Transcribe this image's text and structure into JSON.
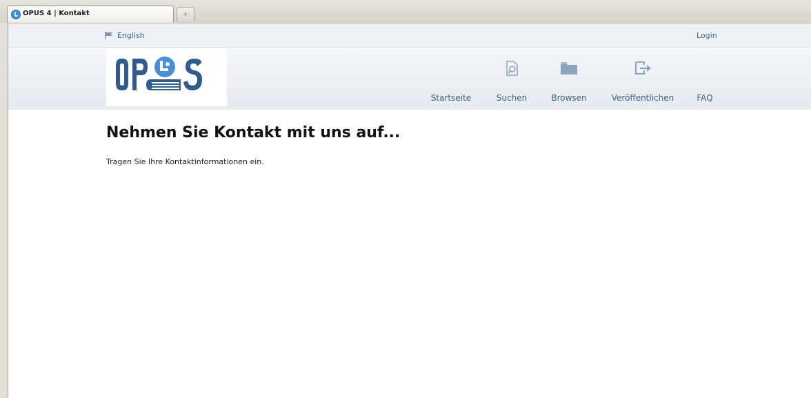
{
  "browser": {
    "tab_title": "OPUS 4 | Kontakt",
    "new_tab_symbol": "+"
  },
  "topbar": {
    "language_link": "English",
    "login_link": "Login"
  },
  "header": {
    "logo_alt": "OPUS",
    "nav": [
      {
        "label": "Startseite",
        "icon": "none"
      },
      {
        "label": "Suchen",
        "icon": "search-document-icon"
      },
      {
        "label": "Browsen",
        "icon": "folder-icon"
      },
      {
        "label": "Veröffentlichen",
        "icon": "publish-arrow-icon"
      },
      {
        "label": "FAQ",
        "icon": "none"
      }
    ]
  },
  "main": {
    "heading": "Nehmen Sie Kontakt mit uns auf...",
    "intro": "Tragen Sie Ihre Kontaktinformationen ein."
  },
  "colors": {
    "link": "#3d6187",
    "logo_blue": "#2f5b8f",
    "logo_accent": "#4a8fd6"
  }
}
